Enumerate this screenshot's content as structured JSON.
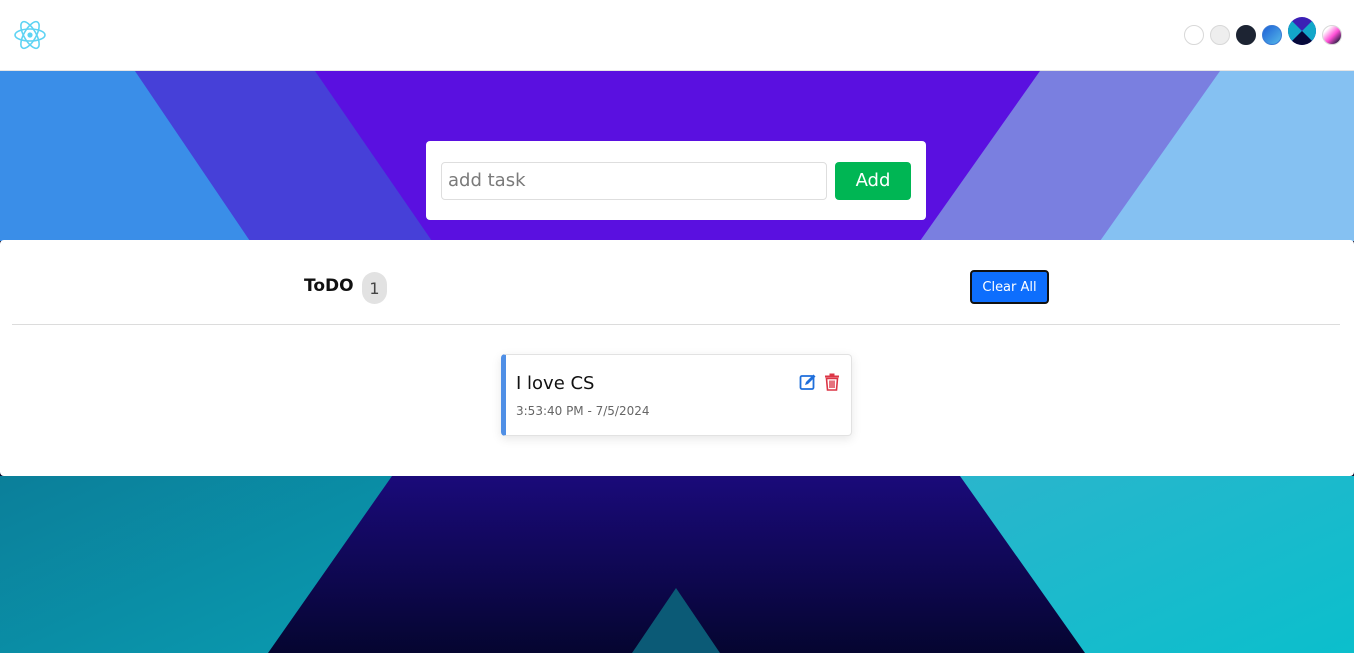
{
  "navbar": {
    "logo_icon": "react-atom-icon",
    "themes": [
      {
        "name": "light",
        "swatch": "#ffffff"
      },
      {
        "name": "gray",
        "swatch": "#eeeeee"
      },
      {
        "name": "dark",
        "swatch": "#1d2433"
      },
      {
        "name": "blue",
        "swatch": "#3a7bd5"
      },
      {
        "name": "purple-x",
        "swatch": "#2a1f8a"
      },
      {
        "name": "pink",
        "swatch": "#ff5ed9"
      }
    ]
  },
  "add_task": {
    "placeholder": "add task",
    "value": "",
    "button_label": "Add"
  },
  "list": {
    "title": "ToDO",
    "count": "1",
    "clear_label": "Clear All",
    "tasks": [
      {
        "text": "I love CS",
        "time": "3:53:40 PM - 7/5/2024"
      }
    ]
  },
  "colors": {
    "add_button": "#00b654",
    "clear_button": "#0d6efd",
    "task_accent": "#4f8fe6",
    "edit_icon": "#1f6fdb",
    "delete_icon": "#dc3545"
  }
}
